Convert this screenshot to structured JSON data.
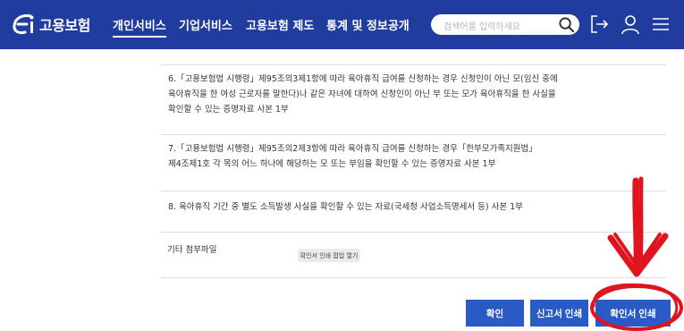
{
  "header": {
    "logo_text": "고용보험",
    "nav": [
      "개인서비스",
      "기업서비스",
      "고용보험 제도",
      "통계 및 정보공개"
    ],
    "search_placeholder": "검색어를 입력하세요",
    "icons": [
      "logout-icon",
      "user-icon",
      "menu-icon"
    ]
  },
  "content": {
    "items": [
      "6.「고용보험법 시행령」제95조의3제1항에 따라 육아휴직 급여를 신청하는 경우 신청인이 아닌 모(임신 중에\n육아휴직을 한 여성 근로자를 말한다)나 같은 자녀에 대하여 신청인이 아닌 부 또는 모가 육아휴직을 한 사실을\n확인할 수 있는 증명자료 사본 1부",
      "7.「고용보험법 시행령」제95조의2제3항에 따라 육아휴직 급여를 신청하는 경우「한부모가족지원법」\n제4조제1호 각 목의 어느 하나에 해당하는 모 또는 부임을 확인할 수 있는 증명자료 사본 1부",
      "8. 육아휴직 기간 중 별도 소득발생 사실을 확인할 수 있는 자료(국세청 사업소득명세서 등) 사본 1부"
    ],
    "attachment_label": "기타 첨부파일",
    "tooltip": "확인서 인쇄 팝업 열기"
  },
  "buttons": {
    "confirm": "확인",
    "report_print": "신고서 인쇄",
    "cert_print": "확인서 인쇄"
  },
  "colors": {
    "header_bg": "#1f3c9e",
    "button_bg": "#2a5ac3",
    "annotation_red": "#e0141e"
  }
}
